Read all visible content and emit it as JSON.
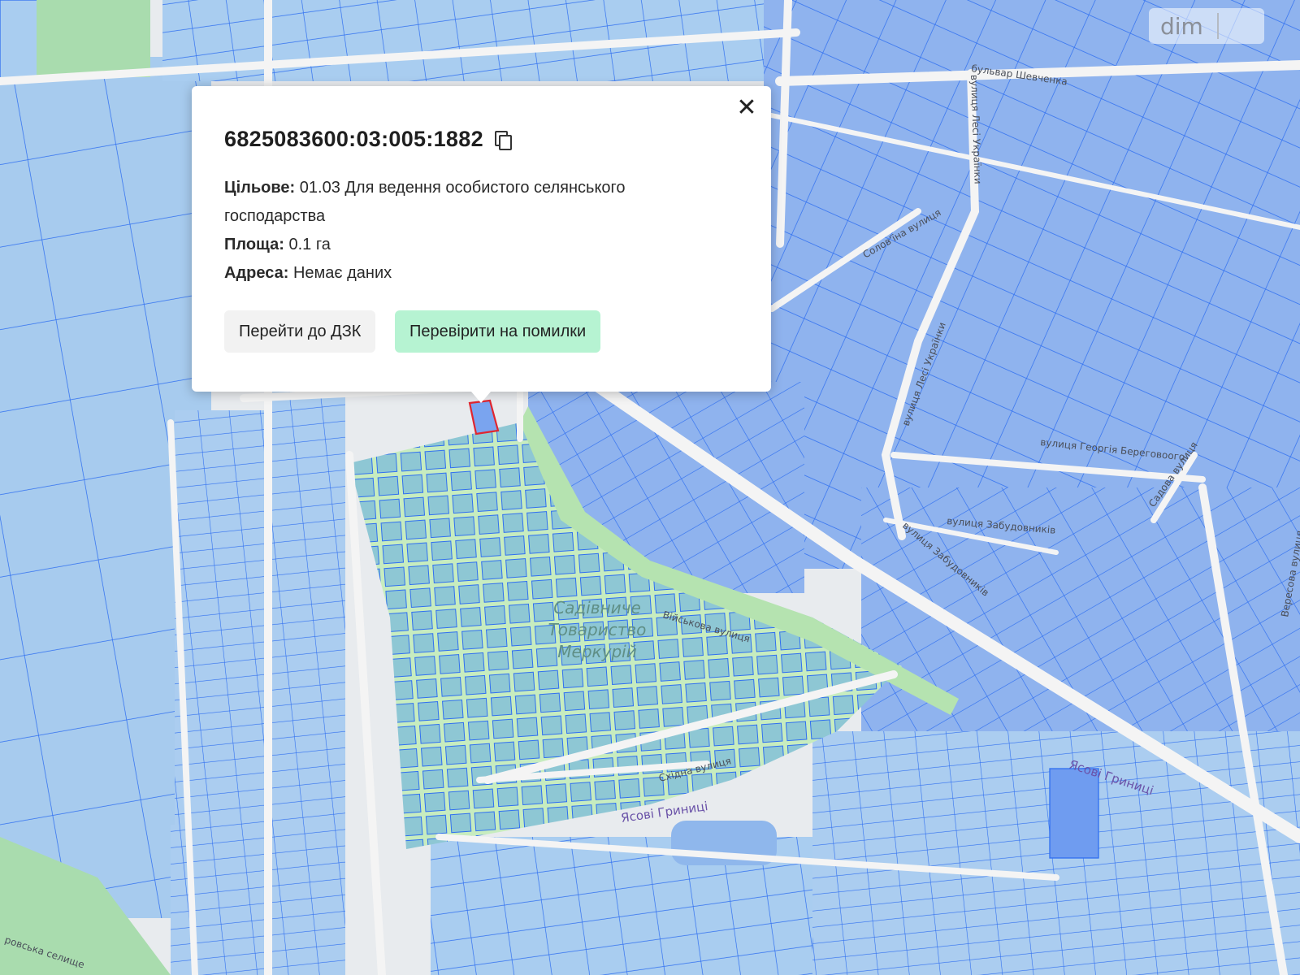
{
  "parcel": {
    "cadastral_number": "6825083600:03:005:1882",
    "purpose_label": "Цільове:",
    "purpose_value": "01.03 Для ведення особистого селянського господарства",
    "area_label": "Площа:",
    "area_value": "0.1 га",
    "address_label": "Адреса:",
    "address_value": "Немає даних"
  },
  "buttons": {
    "go_dzk": "Перейти до ДЗК",
    "check_errors": "Перевірити на помилки"
  },
  "close_symbol": "✕",
  "brand": {
    "logo_text": "dim"
  },
  "map_labels": {
    "street_shevchenko": "бульвар Шевченка",
    "street_lesi": "вулиця Лесі Українки",
    "street_solovyina": "Солов'їна вулиця",
    "street_lesi_2": "вулиця Лесі Українки",
    "street_berehovoho": "вулиця Георгія Береговоого",
    "street_zabudovnykiv": "вулиця Забудовників",
    "street_zabudovnykiv_2": "вулиця Забудовників",
    "street_viiskova": "Військова вулиця",
    "street_skhidna": "Східна вулиця",
    "street_sadova": "Садова вулиця",
    "street_veresova": "Вересова вулиця",
    "street_selyshche": "ровська селище",
    "garden_society": [
      "Садівниче",
      "Товариство",
      "Меркурій"
    ],
    "place_yasovi_1": "Ясові Гриниці",
    "place_yasovi_2": "Ясові Гриниці"
  },
  "colors": {
    "parcel_fill": "#a9cdf0",
    "parcel_fill_dark": "#8fb3ee",
    "parcel_stroke": "#2f6ff0",
    "green_area": "#c7ecbf",
    "road": "#f3f3f3",
    "selected_stroke": "#e0262f",
    "accent_button": "#b6f3d2"
  }
}
